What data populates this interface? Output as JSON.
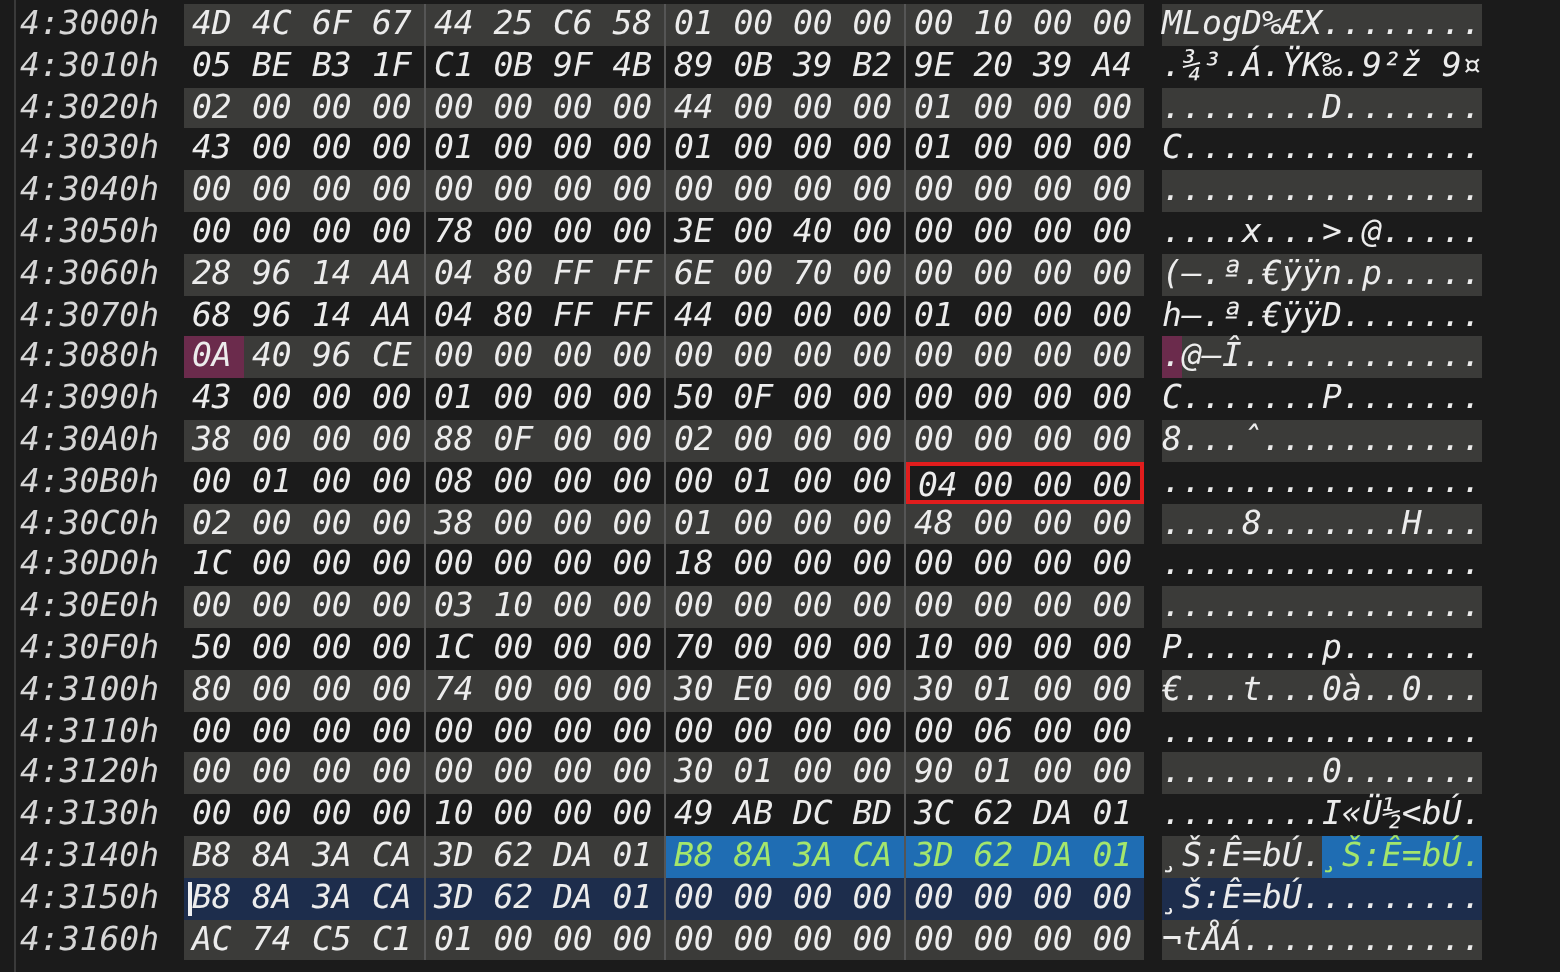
{
  "rows": [
    {
      "address": "4:3000h",
      "current": false,
      "segments": [
        {
          "kind": "plain",
          "hex": [
            "4D",
            "4C",
            "6F",
            "67",
            "44",
            "25",
            "C6",
            "58",
            "01",
            "00",
            "00",
            "00",
            "00",
            "10",
            "00",
            "00"
          ],
          "ascii": "MLogD%ÆX........"
        }
      ]
    },
    {
      "address": "4:3010h",
      "current": false,
      "segments": [
        {
          "kind": "plain",
          "hex": [
            "05",
            "BE",
            "B3",
            "1F",
            "C1",
            "0B",
            "9F",
            "4B",
            "89",
            "0B",
            "39",
            "B2",
            "9E",
            "20",
            "39",
            "A4"
          ],
          "ascii": ".¾³.Á.ŸK‰.9²ž 9¤"
        }
      ]
    },
    {
      "address": "4:3020h",
      "current": false,
      "segments": [
        {
          "kind": "plain",
          "hex": [
            "02",
            "00",
            "00",
            "00",
            "00",
            "00",
            "00",
            "00",
            "44",
            "00",
            "00",
            "00",
            "01",
            "00",
            "00",
            "00"
          ],
          "ascii": "........D......."
        }
      ]
    },
    {
      "address": "4:3030h",
      "current": false,
      "segments": [
        {
          "kind": "plain",
          "hex": [
            "43",
            "00",
            "00",
            "00",
            "01",
            "00",
            "00",
            "00",
            "01",
            "00",
            "00",
            "00",
            "01",
            "00",
            "00",
            "00"
          ],
          "ascii": "C..............."
        }
      ]
    },
    {
      "address": "4:3040h",
      "current": false,
      "segments": [
        {
          "kind": "plain",
          "hex": [
            "00",
            "00",
            "00",
            "00",
            "00",
            "00",
            "00",
            "00",
            "00",
            "00",
            "00",
            "00",
            "00",
            "00",
            "00",
            "00"
          ],
          "ascii": "................"
        }
      ]
    },
    {
      "address": "4:3050h",
      "current": false,
      "segments": [
        {
          "kind": "plain",
          "hex": [
            "00",
            "00",
            "00",
            "00",
            "78",
            "00",
            "00",
            "00",
            "3E",
            "00",
            "40",
            "00",
            "00",
            "00",
            "00",
            "00"
          ],
          "ascii": "....x...>.@....."
        }
      ]
    },
    {
      "address": "4:3060h",
      "current": false,
      "segments": [
        {
          "kind": "plain",
          "hex": [
            "28",
            "96",
            "14",
            "AA",
            "04",
            "80",
            "FF",
            "FF",
            "6E",
            "00",
            "70",
            "00",
            "00",
            "00",
            "00",
            "00"
          ],
          "ascii": "(–.ª.€ÿÿn.p....."
        }
      ]
    },
    {
      "address": "4:3070h",
      "current": false,
      "segments": [
        {
          "kind": "plain",
          "hex": [
            "68",
            "96",
            "14",
            "AA",
            "04",
            "80",
            "FF",
            "FF",
            "44",
            "00",
            "00",
            "00",
            "01",
            "00",
            "00",
            "00"
          ],
          "ascii": "h–.ª.€ÿÿD......."
        }
      ]
    },
    {
      "address": "4:3080h",
      "current": false,
      "segments": [
        {
          "kind": "marked",
          "hex": [
            "0A"
          ],
          "ascii": "."
        },
        {
          "kind": "plain",
          "hex": [
            "40",
            "96",
            "CE",
            "00",
            "00",
            "00",
            "00",
            "00",
            "00",
            "00",
            "00",
            "00",
            "00",
            "00",
            "00"
          ],
          "ascii": "@–Î............"
        }
      ]
    },
    {
      "address": "4:3090h",
      "current": false,
      "segments": [
        {
          "kind": "plain",
          "hex": [
            "43",
            "00",
            "00",
            "00",
            "01",
            "00",
            "00",
            "00",
            "50",
            "0F",
            "00",
            "00",
            "00",
            "00",
            "00",
            "00"
          ],
          "ascii": "C.......P......."
        }
      ]
    },
    {
      "address": "4:30A0h",
      "current": false,
      "segments": [
        {
          "kind": "plain",
          "hex": [
            "38",
            "00",
            "00",
            "00",
            "88",
            "0F",
            "00",
            "00",
            "02",
            "00",
            "00",
            "00",
            "00",
            "00",
            "00",
            "00"
          ],
          "ascii": "8...ˆ..........."
        }
      ]
    },
    {
      "address": "4:30B0h",
      "current": false,
      "segments": [
        {
          "kind": "plain",
          "hex": [
            "00",
            "01",
            "00",
            "00",
            "08",
            "00",
            "00",
            "00",
            "00",
            "01",
            "00",
            "00"
          ],
          "ascii": "............"
        },
        {
          "kind": "boxed",
          "hex": [
            "04",
            "00",
            "00",
            "00"
          ],
          "ascii": "...."
        }
      ]
    },
    {
      "address": "4:30C0h",
      "current": false,
      "segments": [
        {
          "kind": "plain",
          "hex": [
            "02",
            "00",
            "00",
            "00",
            "38",
            "00",
            "00",
            "00",
            "01",
            "00",
            "00",
            "00",
            "48",
            "00",
            "00",
            "00"
          ],
          "ascii": "....8.......H..."
        }
      ]
    },
    {
      "address": "4:30D0h",
      "current": false,
      "segments": [
        {
          "kind": "plain",
          "hex": [
            "1C",
            "00",
            "00",
            "00",
            "00",
            "00",
            "00",
            "00",
            "18",
            "00",
            "00",
            "00",
            "00",
            "00",
            "00",
            "00"
          ],
          "ascii": "................"
        }
      ]
    },
    {
      "address": "4:30E0h",
      "current": false,
      "segments": [
        {
          "kind": "plain",
          "hex": [
            "00",
            "00",
            "00",
            "00",
            "03",
            "10",
            "00",
            "00",
            "00",
            "00",
            "00",
            "00",
            "00",
            "00",
            "00",
            "00"
          ],
          "ascii": "................"
        }
      ]
    },
    {
      "address": "4:30F0h",
      "current": false,
      "segments": [
        {
          "kind": "plain",
          "hex": [
            "50",
            "00",
            "00",
            "00",
            "1C",
            "00",
            "00",
            "00",
            "70",
            "00",
            "00",
            "00",
            "10",
            "00",
            "00",
            "00"
          ],
          "ascii": "P.......p......."
        }
      ]
    },
    {
      "address": "4:3100h",
      "current": false,
      "segments": [
        {
          "kind": "plain",
          "hex": [
            "80",
            "00",
            "00",
            "00",
            "74",
            "00",
            "00",
            "00",
            "30",
            "E0",
            "00",
            "00",
            "30",
            "01",
            "00",
            "00"
          ],
          "ascii": "€...t...0à..0..."
        }
      ]
    },
    {
      "address": "4:3110h",
      "current": false,
      "segments": [
        {
          "kind": "plain",
          "hex": [
            "00",
            "00",
            "00",
            "00",
            "00",
            "00",
            "00",
            "00",
            "00",
            "00",
            "00",
            "00",
            "00",
            "06",
            "00",
            "00"
          ],
          "ascii": "................"
        }
      ]
    },
    {
      "address": "4:3120h",
      "current": false,
      "segments": [
        {
          "kind": "plain",
          "hex": [
            "00",
            "00",
            "00",
            "00",
            "00",
            "00",
            "00",
            "00",
            "30",
            "01",
            "00",
            "00",
            "90",
            "01",
            "00",
            "00"
          ],
          "ascii": "........0......."
        }
      ]
    },
    {
      "address": "4:3130h",
      "current": false,
      "segments": [
        {
          "kind": "plain",
          "hex": [
            "00",
            "00",
            "00",
            "00",
            "10",
            "00",
            "00",
            "00",
            "49",
            "AB",
            "DC",
            "BD",
            "3C",
            "62",
            "DA",
            "01"
          ],
          "ascii": "........I«Ü½<bÚ."
        }
      ]
    },
    {
      "address": "4:3140h",
      "current": false,
      "segments": [
        {
          "kind": "plain",
          "hex": [
            "B8",
            "8A",
            "3A",
            "CA",
            "3D",
            "62",
            "DA",
            "01"
          ],
          "ascii": "¸Š:Ê=bÚ."
        },
        {
          "kind": "selected",
          "hex": [
            "B8",
            "8A",
            "3A",
            "CA",
            "3D",
            "62",
            "DA",
            "01"
          ],
          "ascii": "¸Š:Ê=bÚ."
        }
      ]
    },
    {
      "address": "4:3150h",
      "current": true,
      "segments": [
        {
          "kind": "caret",
          "hex": [
            "B8"
          ],
          "ascii": "¸"
        },
        {
          "kind": "plain",
          "hex": [
            "8A",
            "3A",
            "CA",
            "3D",
            "62",
            "DA",
            "01",
            "00",
            "00",
            "00",
            "00",
            "00",
            "00",
            "00",
            "00"
          ],
          "ascii": "Š:Ê=bÚ........."
        }
      ]
    },
    {
      "address": "4:3160h",
      "current": false,
      "segments": [
        {
          "kind": "plain",
          "hex": [
            "AC",
            "74",
            "C5",
            "C1",
            "01",
            "00",
            "00",
            "00",
            "00",
            "00",
            "00",
            "00",
            "00",
            "00",
            "00",
            "00"
          ],
          "ascii": "¬tÅÁ............"
        }
      ]
    }
  ]
}
